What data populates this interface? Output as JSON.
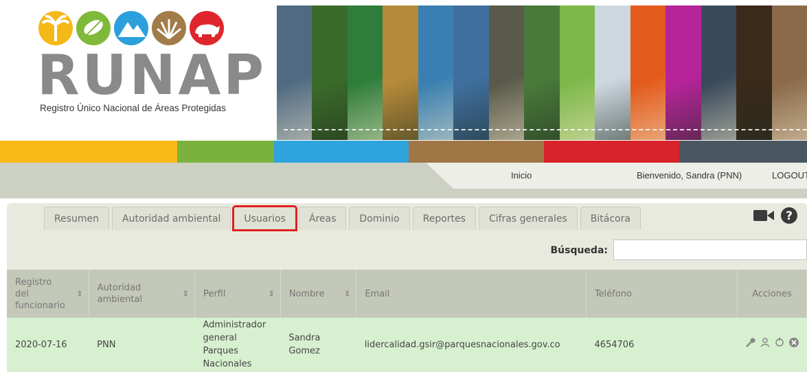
{
  "logo": {
    "wordmark": "RUNAP",
    "subtitle": "Registro Único Nacional de Áreas Protegidas",
    "circle_colors": [
      "#f4b818",
      "#7fb93a",
      "#2c9fdc",
      "#a27b4a",
      "#e0262d"
    ],
    "circle_icons": [
      "palm-tree-icon",
      "leaf-icon",
      "mountain-icon",
      "grass-icon",
      "bear-icon"
    ]
  },
  "banner": {
    "strip_colors": [
      "#4f6a82",
      "#3b6b2a",
      "#2f7d3a",
      "#b58a3a",
      "#3a7fb1",
      "#3f6f9f",
      "#5a5a4a",
      "#4a7a3a",
      "#7fb84a",
      "#cdd7df",
      "#e35a1a",
      "#b7249a",
      "#3a4a5a",
      "#3a2a1a",
      "#8a6a4a"
    ]
  },
  "colorbar": [
    "#f9b918",
    "#7ab23d",
    "#2fa3de",
    "#a07647",
    "#d8232a",
    "#4a5661"
  ],
  "topnav": {
    "home": "Inicio",
    "welcome": "Bienvenido, Sandra (PNN)",
    "logout": "LOGOUT"
  },
  "tabs": [
    {
      "label": "Resumen"
    },
    {
      "label": "Autoridad ambiental"
    },
    {
      "label": "Usuarios"
    },
    {
      "label": "Áreas"
    },
    {
      "label": "Dominio"
    },
    {
      "label": "Reportes"
    },
    {
      "label": "Cifras generales"
    },
    {
      "label": "Bitácora"
    }
  ],
  "tools": {
    "video_icon": "video-camera-icon",
    "help_icon": "help-icon"
  },
  "search": {
    "label": "Búsqueda:",
    "value": ""
  },
  "table": {
    "headers": [
      "Registro del funcionario",
      "Autoridad ambiental",
      "Perfil",
      "Nombre",
      "Email",
      "Teléfono",
      "Acciones"
    ],
    "rows": [
      {
        "registro": "2020-07-16",
        "autoridad": "PNN",
        "perfil": "Administrador general Parques Nacionales",
        "nombre": "Sandra Gomez",
        "email": "lidercalidad.gsir@parquesnacionales.gov.co",
        "telefono": "4654706",
        "actions": [
          "key-icon",
          "user-icon",
          "refresh-icon",
          "delete-icon"
        ]
      }
    ]
  }
}
